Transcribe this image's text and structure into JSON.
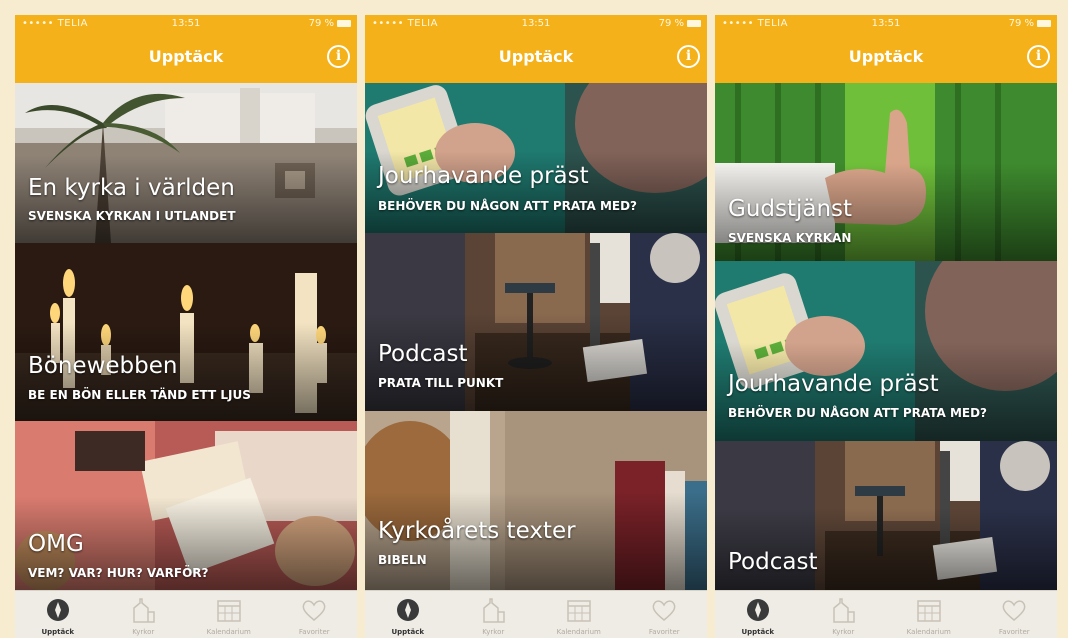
{
  "statusbar": {
    "carrier": "••••• TELIA",
    "time": "13:51",
    "battery": "79 %"
  },
  "phones": [
    {
      "nav_title": "Upptäck",
      "cards": [
        {
          "title": "En kyrka i världen",
          "subtitle": "SVENSKA KYRKAN I UTLANDET"
        },
        {
          "title": "Bönewebben",
          "subtitle": "BE EN BÖN ELLER TÄND ETT LJUS"
        },
        {
          "title": "OMG",
          "subtitle": "VEM? VAR? HUR? VARFÖR?"
        }
      ]
    },
    {
      "nav_title": "Upptäck",
      "cards": [
        {
          "title": "Jourhavande präst",
          "subtitle": "BEHÖVER DU NÅGON ATT PRATA MED?"
        },
        {
          "title": "Podcast",
          "subtitle": "PRATA TILL PUNKT"
        },
        {
          "title": "Kyrkoårets texter",
          "subtitle": "BIBELN"
        }
      ]
    },
    {
      "nav_title": "Upptäck",
      "cards": [
        {
          "title": "Gudstjänst",
          "subtitle": "SVENSKA KYRKAN"
        },
        {
          "title": "Jourhavande präst",
          "subtitle": "BEHÖVER DU NÅGON ATT PRATA MED?"
        },
        {
          "title": "Podcast",
          "subtitle": ""
        }
      ]
    }
  ],
  "tabs": [
    {
      "label": "Upptäck",
      "icon": "compass-icon",
      "active": true
    },
    {
      "label": "Kyrkor",
      "icon": "church-icon",
      "active": false
    },
    {
      "label": "Kalendarium",
      "icon": "calendar-icon",
      "active": false
    },
    {
      "label": "Favoriter",
      "icon": "heart-icon",
      "active": false
    }
  ],
  "colors": {
    "accent": "#f5b119",
    "tabbar": "#efece6",
    "background": "#f7ecd0"
  }
}
